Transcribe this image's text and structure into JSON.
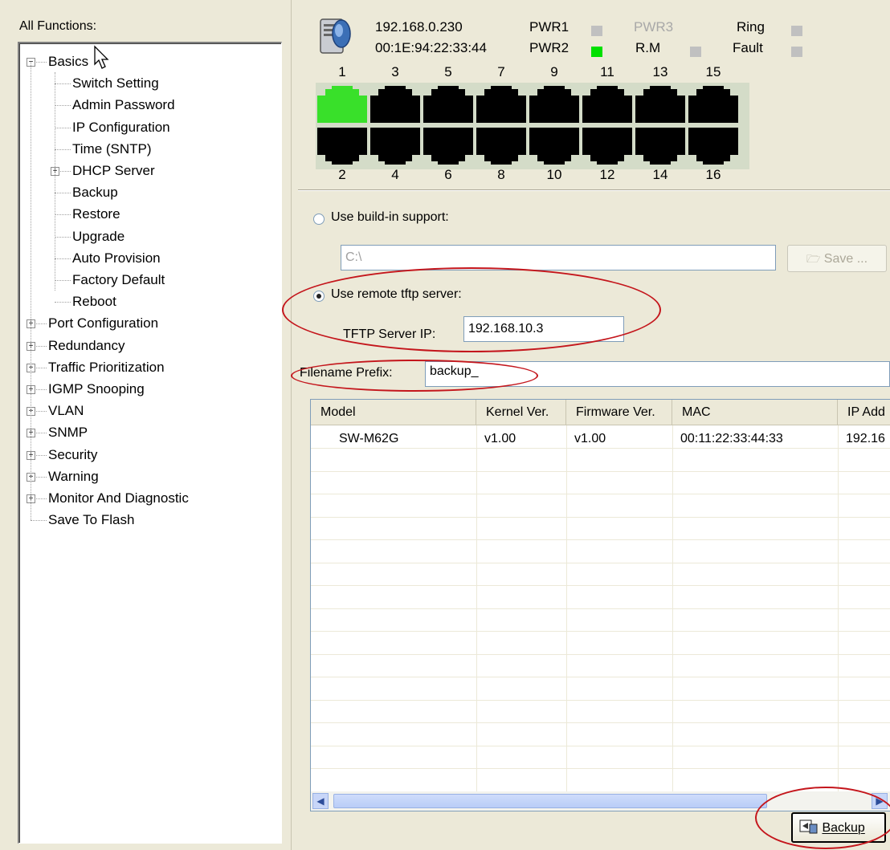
{
  "tree": {
    "header": "All Functions:",
    "items": [
      {
        "label": "Basics",
        "level": 0,
        "expander": "minus"
      },
      {
        "label": "Switch Setting",
        "level": 1
      },
      {
        "label": "Admin Password",
        "level": 1
      },
      {
        "label": "IP Configuration",
        "level": 1
      },
      {
        "label": "Time (SNTP)",
        "level": 1
      },
      {
        "label": "DHCP Server",
        "level": 1,
        "expander": "plus"
      },
      {
        "label": "Backup",
        "level": 1,
        "selected": true
      },
      {
        "label": "Restore",
        "level": 1
      },
      {
        "label": "Upgrade",
        "level": 1
      },
      {
        "label": "Auto Provision",
        "level": 1
      },
      {
        "label": "Factory Default",
        "level": 1
      },
      {
        "label": "Reboot",
        "level": 1
      },
      {
        "label": "Port Configuration",
        "level": 0,
        "expander": "plus"
      },
      {
        "label": "Redundancy",
        "level": 0,
        "expander": "plus"
      },
      {
        "label": "Traffic Prioritization",
        "level": 0,
        "expander": "plus"
      },
      {
        "label": "IGMP Snooping",
        "level": 0,
        "expander": "plus"
      },
      {
        "label": "VLAN",
        "level": 0,
        "expander": "plus"
      },
      {
        "label": "SNMP",
        "level": 0,
        "expander": "plus"
      },
      {
        "label": "Security",
        "level": 0,
        "expander": "plus"
      },
      {
        "label": "Warning",
        "level": 0,
        "expander": "plus"
      },
      {
        "label": "Monitor And Diagnostic",
        "level": 0,
        "expander": "plus"
      },
      {
        "label": "Save To Flash",
        "level": 0
      }
    ]
  },
  "status": {
    "ip": "192.168.0.230",
    "mac": "00:1E:94:22:33:44",
    "pwr1": "PWR1",
    "pwr2": "PWR2",
    "pwr3": "PWR3",
    "rm": "R.M",
    "ring": "Ring",
    "fault": "Fault",
    "led_on_color": "#00e000",
    "led_off_color": "#c0c0c0"
  },
  "ports": {
    "top": [
      "1",
      "3",
      "5",
      "7",
      "9",
      "11",
      "13",
      "15"
    ],
    "bottom": [
      "2",
      "4",
      "6",
      "8",
      "10",
      "12",
      "14",
      "16"
    ],
    "link_up": [
      "1"
    ],
    "link_color": "#39e02a"
  },
  "backup": {
    "build_in_label": "Use build-in support:",
    "path_value": "C:\\",
    "save_label": "Save ...",
    "remote_label": "Use remote tftp server:",
    "tftp_label": "TFTP Server IP:",
    "tftp_value": "192.168.10.3",
    "prefix_label": "Filename Prefix:",
    "prefix_value": "backup_",
    "backup_button": "Backup"
  },
  "table": {
    "columns": [
      "Model",
      "Kernel Ver.",
      "Firmware Ver.",
      "MAC",
      "IP Add"
    ],
    "rows": [
      [
        "SW-M62G",
        "v1.00",
        "v1.00",
        "00:11:22:33:44:33",
        "192.16"
      ]
    ]
  },
  "annotation_color": "#c4161c"
}
